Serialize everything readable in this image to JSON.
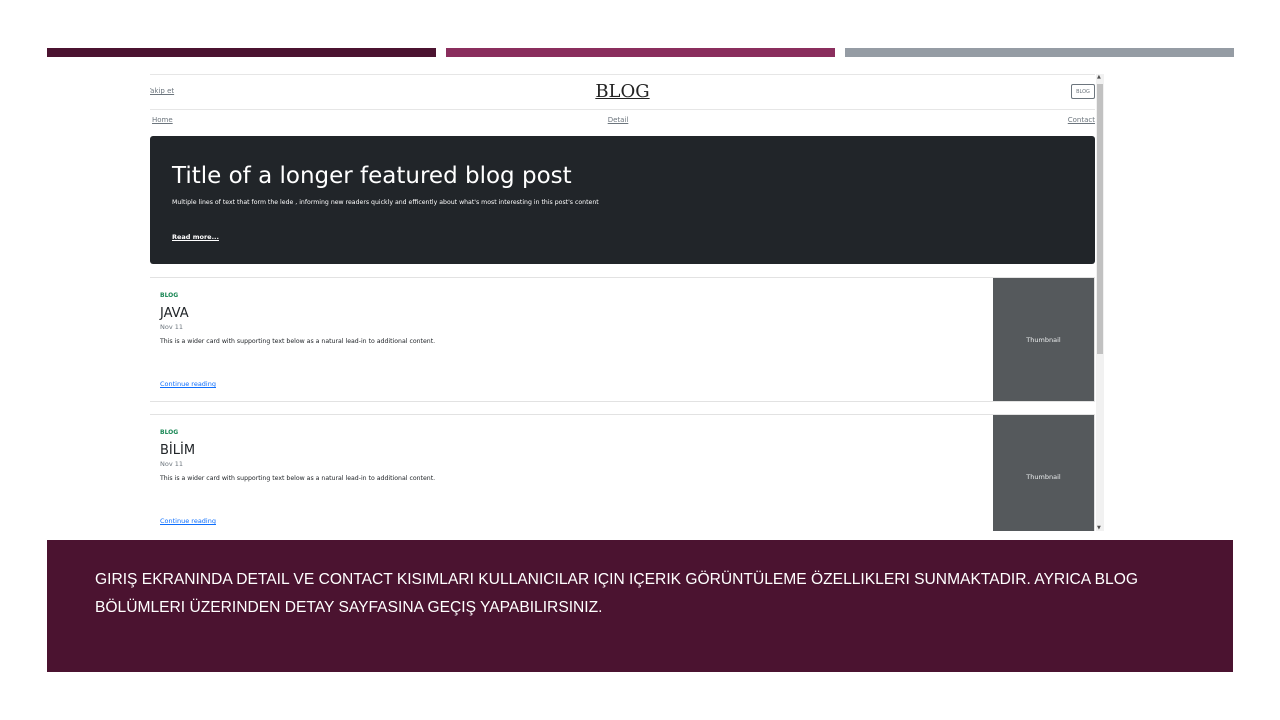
{
  "site": {
    "follow_link": "Takip et",
    "brand": "BLOG",
    "header_button": "BLOG"
  },
  "nav": {
    "items": [
      "Home",
      "Detail",
      "Contact"
    ]
  },
  "hero": {
    "title": "Title of a longer featured blog post",
    "lede": "Multiple lines of text that form the lede , informing new readers quickly and efficently about what's most interesting in this post's content",
    "read_more": "Read more..."
  },
  "cards": [
    {
      "category": "BLOG",
      "title": "JAVA",
      "date": "Nov 11",
      "text": "This is a wider card with supporting text below as a natural lead-in to additional content.",
      "link": "Continue reading",
      "thumbnail": "Thumbnail"
    },
    {
      "category": "BLOG",
      "title": "BİLİM",
      "date": "Nov 11",
      "text": "This is a wider card with supporting text below as a natural lead-in to additional content.",
      "link": "Continue reading",
      "thumbnail": "Thumbnail"
    }
  ],
  "scrollbar": {
    "up_icon": "▲",
    "down_icon": "▼"
  },
  "banner": {
    "text": "GIRIŞ EKRANINDA  DETAIL VE CONTACT KISIMLARI KULLANICILAR IÇIN IÇERIK GÖRÜNTÜLEME ÖZELLIKLERI SUNMAKTADIR. AYRICA BLOG BÖLÜMLERI ÜZERINDEN DETAY SAYFASINA GEÇIŞ YAPABILIRSINIZ."
  },
  "colors": {
    "accent_dark": "#4b1330",
    "accent_mid": "#8a2e5d",
    "accent_grey": "#959ca4",
    "hero_bg": "#212529",
    "category_green": "#198754",
    "link_blue": "#0d6efd"
  }
}
